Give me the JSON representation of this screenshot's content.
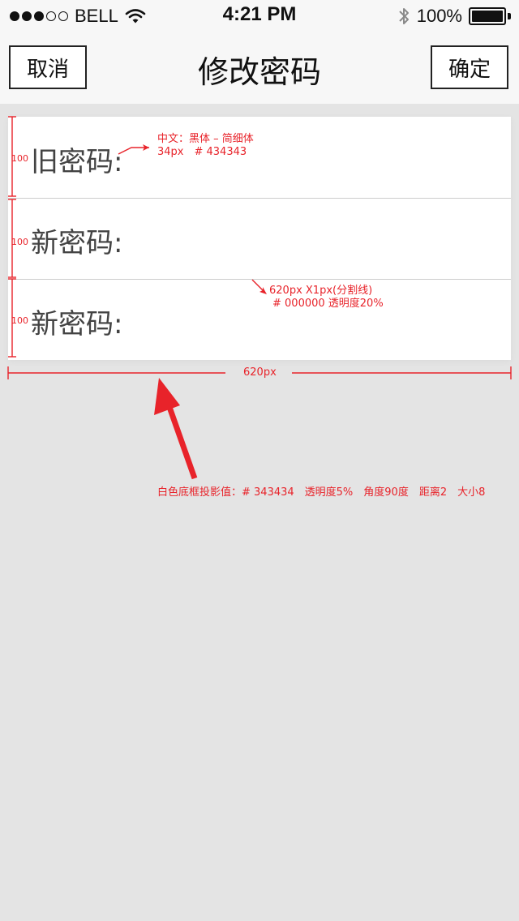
{
  "status_bar": {
    "carrier": "BELL",
    "time": "4:21 PM",
    "battery": "100%",
    "signal_bars": 3,
    "signal_total": 5,
    "icons": [
      "wifi-icon",
      "bluetooth-icon",
      "battery-icon"
    ]
  },
  "nav": {
    "cancel_label": "取消",
    "title": "修改密码",
    "confirm_label": "确定"
  },
  "form": {
    "rows": [
      {
        "label": "旧密码:",
        "value": ""
      },
      {
        "label": "新密码:",
        "value": ""
      },
      {
        "label": "新密码:",
        "value": ""
      }
    ]
  },
  "annotations": {
    "font_spec": [
      "中文：黑体 – 简细体",
      "34px　# 434343"
    ],
    "divider_spec": [
      "620px X1px(分割线)",
      "# 000000  透明度20%"
    ],
    "width_label": "620px",
    "row_height": "100",
    "shadow_spec": "白色底框投影值：# 343434　透明度5%　角度90度　距离2　大小8"
  },
  "colors": {
    "background": "#e4e4e4",
    "label_text": "#434343",
    "annotation": "#e8232a"
  }
}
